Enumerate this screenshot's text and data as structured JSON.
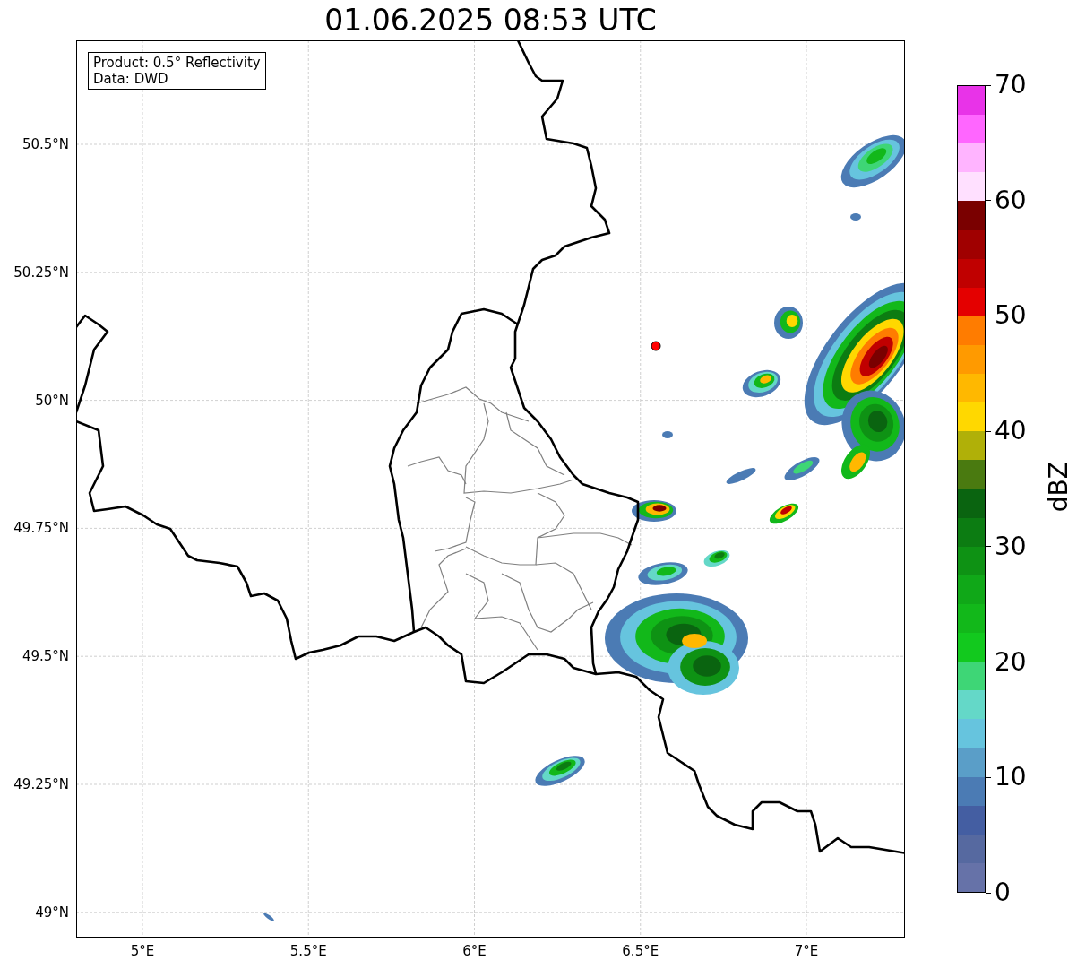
{
  "figure": {
    "title": "01.06.2025 08:53 UTC"
  },
  "map": {
    "info_box": [
      "Product: 0.5° Reflectivity",
      "Data: DWD"
    ],
    "x_ticks": [
      "5°E",
      "5.5°E",
      "6°E",
      "6.5°E",
      "7°E"
    ],
    "y_ticks": [
      "50.5°N",
      "50.25°N",
      "50°N",
      "49.75°N",
      "49.5°N",
      "49.25°N",
      "49°N"
    ]
  },
  "colorbar": {
    "label": "dBZ",
    "ticks": [
      "70",
      "60",
      "50",
      "40",
      "30",
      "20",
      "10",
      "0"
    ],
    "bins": [
      {
        "color": "#e833e8"
      },
      {
        "color": "#ff66ff"
      },
      {
        "color": "#ffb4ff"
      },
      {
        "color": "#ffe0ff"
      },
      {
        "color": "#7a0000"
      },
      {
        "color": "#a00000"
      },
      {
        "color": "#c00000"
      },
      {
        "color": "#e40000"
      },
      {
        "color": "#ff7c00"
      },
      {
        "color": "#ff9a00"
      },
      {
        "color": "#ffb800"
      },
      {
        "color": "#ffd800"
      },
      {
        "color": "#b0b008"
      },
      {
        "color": "#4a7a10"
      },
      {
        "color": "#0a6410"
      },
      {
        "color": "#0c7c12"
      },
      {
        "color": "#0e9214"
      },
      {
        "color": "#10a818"
      },
      {
        "color": "#12b81a"
      },
      {
        "color": "#12c91e"
      },
      {
        "color": "#3ed676"
      },
      {
        "color": "#64d8c8"
      },
      {
        "color": "#66c4de"
      },
      {
        "color": "#5a9ec8"
      },
      {
        "color": "#4b7bb4"
      },
      {
        "color": "#445ea2"
      },
      {
        "color": "#5669a0"
      },
      {
        "color": "#6672a8"
      }
    ]
  }
}
